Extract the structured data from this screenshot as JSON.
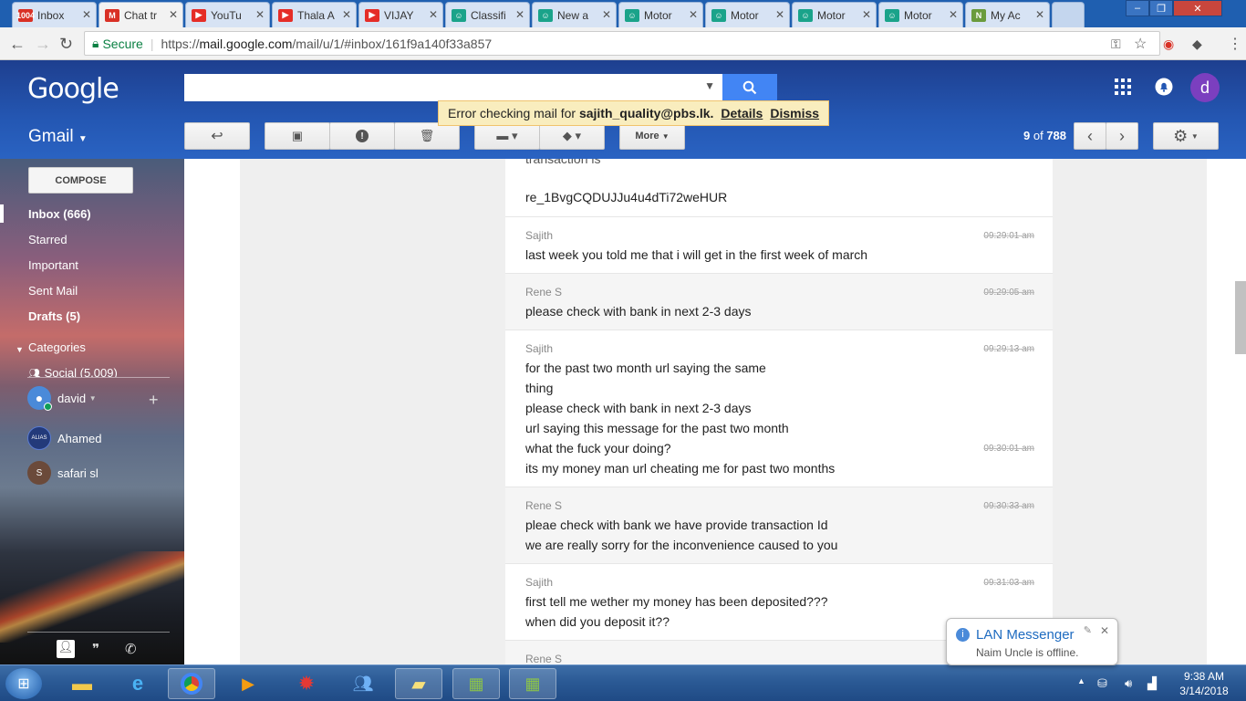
{
  "browser": {
    "tabs": [
      {
        "label": "Inbox",
        "icon": "gmail-icon",
        "fav_color": "#d93025",
        "fav_text": "1004"
      },
      {
        "label": "Chat tr",
        "icon": "gmail-icon",
        "fav_color": "#d93025",
        "fav_text": "M"
      },
      {
        "label": "YouTu",
        "icon": "youtube-icon",
        "fav_color": "#e52d27",
        "fav_text": "▶"
      },
      {
        "label": "Thala A",
        "icon": "youtube-icon",
        "fav_color": "#e52d27",
        "fav_text": "▶"
      },
      {
        "label": "VIJAY",
        "icon": "youtube-icon",
        "fav_color": "#e52d27",
        "fav_text": "▶"
      },
      {
        "label": "Classifi",
        "icon": "robot-icon",
        "fav_color": "#1aa38a",
        "fav_text": "☺"
      },
      {
        "label": "New a",
        "icon": "robot-icon",
        "fav_color": "#1aa38a",
        "fav_text": "☺"
      },
      {
        "label": "Motor",
        "icon": "robot-icon",
        "fav_color": "#1aa38a",
        "fav_text": "☺"
      },
      {
        "label": "Motor",
        "icon": "robot-icon",
        "fav_color": "#1aa38a",
        "fav_text": "☺"
      },
      {
        "label": "Motor",
        "icon": "robot-icon",
        "fav_color": "#1aa38a",
        "fav_text": "☺"
      },
      {
        "label": "Motor",
        "icon": "robot-icon",
        "fav_color": "#1aa38a",
        "fav_text": "☺"
      },
      {
        "label": "My Ac",
        "icon": "leaf-icon",
        "fav_color": "#6a9b3c",
        "fav_text": "N"
      }
    ],
    "active_tab_index": 1,
    "secure_label": "Secure",
    "url_prefix": "https://",
    "url_host": "mail.google.com",
    "url_path": "/mail/u/1/#inbox/161f9a140f33a857"
  },
  "gmail": {
    "logo": "Google",
    "app_label": "Gmail",
    "search": {
      "value": ""
    },
    "notice": {
      "prefix": "Error checking mail for",
      "email": "sajith_quality@pbs.lk.",
      "details": "Details",
      "dismiss": "Dismiss"
    },
    "more_label": "More",
    "pager": {
      "range": "9",
      "of_label": "of",
      "total": "788"
    },
    "avatar_letter": "d",
    "compose_label": "COMPOSE",
    "nav": [
      {
        "label": "Inbox (666)",
        "bold": true
      },
      {
        "label": "Starred",
        "bold": false
      },
      {
        "label": "Important",
        "bold": false
      },
      {
        "label": "Sent Mail",
        "bold": false
      },
      {
        "label": "Drafts (5)",
        "bold": true
      }
    ],
    "categories_label": "Categories",
    "social_label": "Social (5,009)",
    "contacts": [
      {
        "name": "david",
        "color": "#4a8ad9",
        "initial": "",
        "online": true
      },
      {
        "name": "Ahamed",
        "color": "#233a7a",
        "initial": "ALIAS",
        "online": false
      },
      {
        "name": "safari sl",
        "color": "#6b4a3a",
        "initial": "S",
        "online": false
      }
    ]
  },
  "chat": {
    "top_partial": "transaction is",
    "top_line": "re_1BvgCQDUJJu4u4dTi72weHUR",
    "messages": [
      {
        "sender": "Sajith",
        "time": "09:29:01 am",
        "lines": [
          "last week you told me that i will get in the first week of march"
        ],
        "alt": false,
        "extra_time": ""
      },
      {
        "sender": "Rene S",
        "time": "09:29:05 am",
        "lines": [
          "please check with bank in next 2-3 days"
        ],
        "alt": true,
        "extra_time": ""
      },
      {
        "sender": "Sajith",
        "time": "09:29:13 am",
        "lines": [
          "for the past two month url saying the same",
          "thing",
          "please check with bank in next 2-3 days",
          "url saying this message for the past two month",
          "what the fuck your doing?",
          "its my money man url cheating me for past two months"
        ],
        "alt": false,
        "extra_time": "09:30:01 am"
      },
      {
        "sender": "Rene S",
        "time": "09:30:33 am",
        "lines": [
          "pleae check with bank we have provide transaction Id",
          "we are really sorry for the inconvenience caused to you"
        ],
        "alt": true,
        "extra_time": ""
      },
      {
        "sender": "Sajith",
        "time": "09:31:03 am",
        "lines": [
          "first tell me wether my money has been deposited???",
          "when did you deposit it??"
        ],
        "alt": false,
        "extra_time": ""
      },
      {
        "sender": "Rene S",
        "time": "",
        "lines": [],
        "alt": true,
        "extra_time": ""
      }
    ]
  },
  "lan_messenger": {
    "title": "LAN Messenger",
    "message": "Naim Uncle is offline."
  },
  "taskbar": {
    "time": "9:38 AM",
    "date": "3/14/2018"
  }
}
